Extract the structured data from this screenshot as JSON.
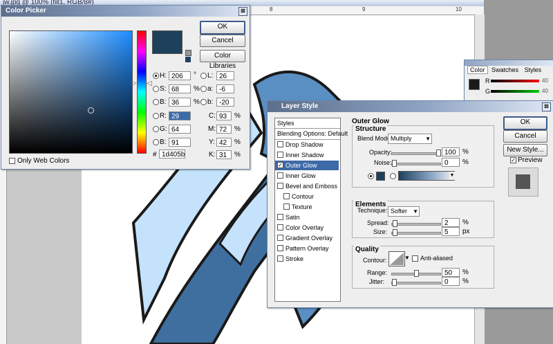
{
  "document": {
    "title": "jw.jpg @ 100% (fill1, RGB/8#)",
    "ruler_top": [
      "8",
      "9",
      "10"
    ]
  },
  "color_picker": {
    "title": "Color Picker",
    "ok": "OK",
    "cancel": "Cancel",
    "color_libraries": "Color Libraries",
    "only_web_colors": "Only Web Colors",
    "fields": {
      "h": {
        "label": "H:",
        "value": "206",
        "unit": "°"
      },
      "s": {
        "label": "S:",
        "value": "68",
        "unit": "%"
      },
      "b": {
        "label": "B:",
        "value": "36",
        "unit": "%"
      },
      "r": {
        "label": "R:",
        "value": "29"
      },
      "g": {
        "label": "G:",
        "value": "64"
      },
      "b2": {
        "label": "B:",
        "value": "91"
      },
      "l": {
        "label": "L:",
        "value": "26"
      },
      "a": {
        "label": "a:",
        "value": "-6"
      },
      "b3": {
        "label": "b:",
        "value": "-20"
      },
      "c": {
        "label": "C:",
        "value": "93",
        "unit": "%"
      },
      "m": {
        "label": "M:",
        "value": "72",
        "unit": "%"
      },
      "y": {
        "label": "Y:",
        "value": "42",
        "unit": "%"
      },
      "k": {
        "label": "K:",
        "value": "31",
        "unit": "%"
      }
    },
    "hex_label": "#",
    "hex": "1d405b",
    "current_color": "#1d405b",
    "field_color": "#1d8cff"
  },
  "color_panel": {
    "tabs": [
      "Color",
      "Swatches",
      "Styles"
    ],
    "r_label": "R",
    "g_label": "G",
    "r_value": "40",
    "g_value": "40"
  },
  "layer_style": {
    "title": "Layer Style",
    "styles_header": "Styles",
    "blending": "Blending Options: Default",
    "items": [
      {
        "label": "Drop Shadow",
        "checked": false,
        "indent": false,
        "selected": false
      },
      {
        "label": "Inner Shadow",
        "checked": false,
        "indent": false,
        "selected": false
      },
      {
        "label": "Outer Glow",
        "checked": true,
        "indent": false,
        "selected": true
      },
      {
        "label": "Inner Glow",
        "checked": false,
        "indent": false,
        "selected": false
      },
      {
        "label": "Bevel and Emboss",
        "checked": false,
        "indent": false,
        "selected": false
      },
      {
        "label": "Contour",
        "checked": false,
        "indent": true,
        "selected": false
      },
      {
        "label": "Texture",
        "checked": false,
        "indent": true,
        "selected": false
      },
      {
        "label": "Satin",
        "checked": false,
        "indent": false,
        "selected": false
      },
      {
        "label": "Color Overlay",
        "checked": false,
        "indent": false,
        "selected": false
      },
      {
        "label": "Gradient Overlay",
        "checked": false,
        "indent": false,
        "selected": false
      },
      {
        "label": "Pattern Overlay",
        "checked": false,
        "indent": false,
        "selected": false
      },
      {
        "label": "Stroke",
        "checked": false,
        "indent": false,
        "selected": false
      }
    ],
    "ok": "OK",
    "cancel": "Cancel",
    "new_style": "New Style...",
    "preview": "Preview",
    "outer_glow": "Outer Glow",
    "structure": {
      "title": "Structure",
      "blend_mode_label": "Blend Mode:",
      "blend_mode": "Multiply",
      "opacity_label": "Opacity:",
      "opacity": "100",
      "opacity_unit": "%",
      "opacity_fraction": 1.0,
      "noise_label": "Noise:",
      "noise": "0",
      "noise_unit": "%",
      "noise_fraction": 0.0,
      "glow_color": "#1d405b"
    },
    "elements": {
      "title": "Elements",
      "technique_label": "Technique:",
      "technique": "Softer",
      "spread_label": "Spread:",
      "spread": "2",
      "spread_unit": "%",
      "spread_fraction": 0.02,
      "size_label": "Size:",
      "size": "5",
      "size_unit": "px",
      "size_fraction": 0.02
    },
    "quality": {
      "title": "Quality",
      "contour_label": "Contour:",
      "anti_aliased": "Anti-aliased",
      "range_label": "Range:",
      "range": "50",
      "range_unit": "%",
      "range_fraction": 0.5,
      "jitter_label": "Jitter:",
      "jitter": "0",
      "jitter_unit": "%",
      "jitter_fraction": 0.0
    }
  },
  "colors": {
    "dialog_bg": "#eeeeee",
    "titlebar": "#5c6f8c",
    "artwork_dark": "#3f6f9f",
    "artwork_mid": "#5a8fc4",
    "artwork_light": "#c4e2fb",
    "selection": "#3d6aa8"
  }
}
